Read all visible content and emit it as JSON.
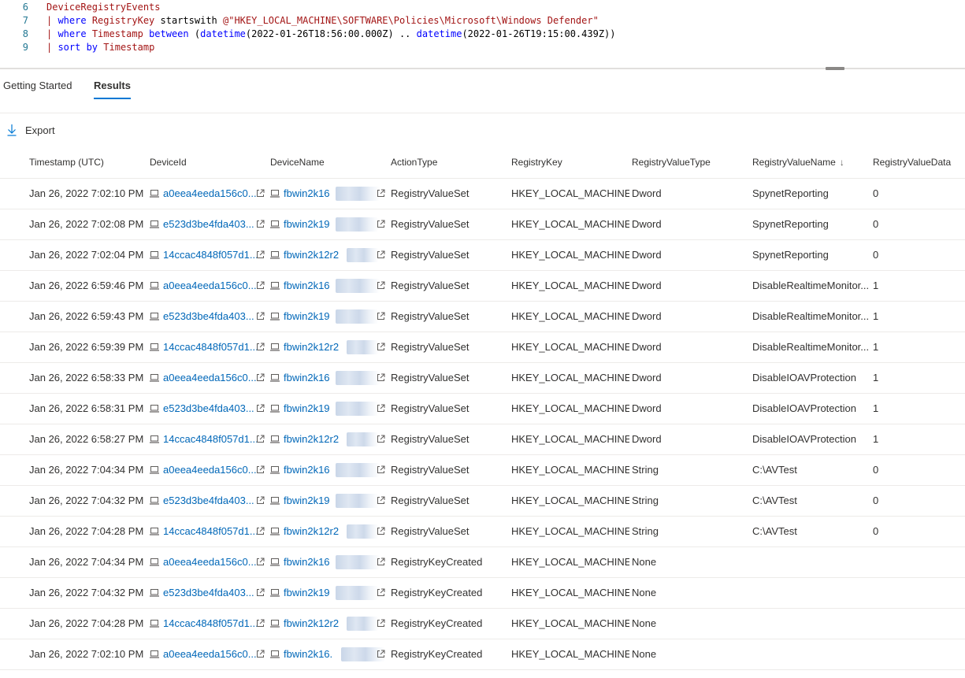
{
  "editor": {
    "lines": [
      {
        "num": "6",
        "tokens": [
          {
            "t": "DeviceRegistryEvents",
            "c": "table"
          }
        ]
      },
      {
        "num": "7",
        "tokens": [
          {
            "t": "| ",
            "c": "pipe"
          },
          {
            "t": "where ",
            "c": "kw"
          },
          {
            "t": "RegistryKey ",
            "c": "ident"
          },
          {
            "t": "startswith ",
            "c": "plain"
          },
          {
            "t": "@\"HKEY_LOCAL_MACHINE\\SOFTWARE\\Policies\\Microsoft\\Windows Defender\"",
            "c": "str"
          }
        ]
      },
      {
        "num": "8",
        "tokens": [
          {
            "t": "| ",
            "c": "pipe"
          },
          {
            "t": "where ",
            "c": "kw"
          },
          {
            "t": "Timestamp ",
            "c": "ident"
          },
          {
            "t": "between ",
            "c": "kw"
          },
          {
            "t": "(",
            "c": "plain"
          },
          {
            "t": "datetime",
            "c": "fn"
          },
          {
            "t": "(2022-01-26T18:56:00.000Z) .. ",
            "c": "plain"
          },
          {
            "t": "datetime",
            "c": "fn"
          },
          {
            "t": "(2022-01-26T19:15:00.439Z))",
            "c": "plain"
          }
        ]
      },
      {
        "num": "9",
        "tokens": [
          {
            "t": "| ",
            "c": "pipe"
          },
          {
            "t": "sort ",
            "c": "kw"
          },
          {
            "t": "by ",
            "c": "kw"
          },
          {
            "t": "Timestamp",
            "c": "ident"
          }
        ]
      }
    ]
  },
  "tabs": {
    "getting_started": "Getting Started",
    "results": "Results"
  },
  "toolbar": {
    "export_label": "Export",
    "export_icon": "download-arrow-icon"
  },
  "grid": {
    "columns": {
      "timestamp": "Timestamp (UTC)",
      "device_id": "DeviceId",
      "device_name": "DeviceName",
      "action_type": "ActionType",
      "registry_key": "RegistryKey",
      "registry_value_type": "RegistryValueType",
      "registry_value_name": "RegistryValueName",
      "registry_value_data": "RegistryValueData"
    },
    "sort_indicator": "↓",
    "rows": [
      {
        "timestamp": "Jan 26, 2022 7:02:10 PM",
        "device_id": "a0eea4eeda156c0...",
        "device_name": "fbwin2k16",
        "action_type": "RegistryValueSet",
        "registry_key": "HKEY_LOCAL_MACHINE...",
        "value_type": "Dword",
        "value_name": "SpynetReporting",
        "value_data": "0"
      },
      {
        "timestamp": "Jan 26, 2022 7:02:08 PM",
        "device_id": "e523d3be4fda403...",
        "device_name": "fbwin2k19",
        "action_type": "RegistryValueSet",
        "registry_key": "HKEY_LOCAL_MACHINE...",
        "value_type": "Dword",
        "value_name": "SpynetReporting",
        "value_data": "0"
      },
      {
        "timestamp": "Jan 26, 2022 7:02:04 PM",
        "device_id": "14ccac4848f057d1...",
        "device_name": "fbwin2k12r2",
        "action_type": "RegistryValueSet",
        "registry_key": "HKEY_LOCAL_MACHINE...",
        "value_type": "Dword",
        "value_name": "SpynetReporting",
        "value_data": "0"
      },
      {
        "timestamp": "Jan 26, 2022 6:59:46 PM",
        "device_id": "a0eea4eeda156c0...",
        "device_name": "fbwin2k16",
        "action_type": "RegistryValueSet",
        "registry_key": "HKEY_LOCAL_MACHINE...",
        "value_type": "Dword",
        "value_name": "DisableRealtimeMonitor...",
        "value_data": "1"
      },
      {
        "timestamp": "Jan 26, 2022 6:59:43 PM",
        "device_id": "e523d3be4fda403...",
        "device_name": "fbwin2k19",
        "action_type": "RegistryValueSet",
        "registry_key": "HKEY_LOCAL_MACHINE...",
        "value_type": "Dword",
        "value_name": "DisableRealtimeMonitor...",
        "value_data": "1"
      },
      {
        "timestamp": "Jan 26, 2022 6:59:39 PM",
        "device_id": "14ccac4848f057d1...",
        "device_name": "fbwin2k12r2",
        "action_type": "RegistryValueSet",
        "registry_key": "HKEY_LOCAL_MACHINE...",
        "value_type": "Dword",
        "value_name": "DisableRealtimeMonitor...",
        "value_data": "1"
      },
      {
        "timestamp": "Jan 26, 2022 6:58:33 PM",
        "device_id": "a0eea4eeda156c0...",
        "device_name": "fbwin2k16",
        "action_type": "RegistryValueSet",
        "registry_key": "HKEY_LOCAL_MACHINE...",
        "value_type": "Dword",
        "value_name": "DisableIOAVProtection",
        "value_data": "1"
      },
      {
        "timestamp": "Jan 26, 2022 6:58:31 PM",
        "device_id": "e523d3be4fda403...",
        "device_name": "fbwin2k19",
        "action_type": "RegistryValueSet",
        "registry_key": "HKEY_LOCAL_MACHINE...",
        "value_type": "Dword",
        "value_name": "DisableIOAVProtection",
        "value_data": "1"
      },
      {
        "timestamp": "Jan 26, 2022 6:58:27 PM",
        "device_id": "14ccac4848f057d1...",
        "device_name": "fbwin2k12r2",
        "action_type": "RegistryValueSet",
        "registry_key": "HKEY_LOCAL_MACHINE...",
        "value_type": "Dword",
        "value_name": "DisableIOAVProtection",
        "value_data": "1"
      },
      {
        "timestamp": "Jan 26, 2022 7:04:34 PM",
        "device_id": "a0eea4eeda156c0...",
        "device_name": "fbwin2k16",
        "action_type": "RegistryValueSet",
        "registry_key": "HKEY_LOCAL_MACHINE...",
        "value_type": "String",
        "value_name": "C:\\AVTest",
        "value_data": "0"
      },
      {
        "timestamp": "Jan 26, 2022 7:04:32 PM",
        "device_id": "e523d3be4fda403...",
        "device_name": "fbwin2k19",
        "action_type": "RegistryValueSet",
        "registry_key": "HKEY_LOCAL_MACHINE...",
        "value_type": "String",
        "value_name": "C:\\AVTest",
        "value_data": "0"
      },
      {
        "timestamp": "Jan 26, 2022 7:04:28 PM",
        "device_id": "14ccac4848f057d1...",
        "device_name": "fbwin2k12r2",
        "action_type": "RegistryValueSet",
        "registry_key": "HKEY_LOCAL_MACHINE...",
        "value_type": "String",
        "value_name": "C:\\AVTest",
        "value_data": "0"
      },
      {
        "timestamp": "Jan 26, 2022 7:04:34 PM",
        "device_id": "a0eea4eeda156c0...",
        "device_name": "fbwin2k16",
        "action_type": "RegistryKeyCreated",
        "registry_key": "HKEY_LOCAL_MACHINE...",
        "value_type": "None",
        "value_name": "",
        "value_data": ""
      },
      {
        "timestamp": "Jan 26, 2022 7:04:32 PM",
        "device_id": "e523d3be4fda403...",
        "device_name": "fbwin2k19",
        "action_type": "RegistryKeyCreated",
        "registry_key": "HKEY_LOCAL_MACHINE...",
        "value_type": "None",
        "value_name": "",
        "value_data": ""
      },
      {
        "timestamp": "Jan 26, 2022 7:04:28 PM",
        "device_id": "14ccac4848f057d1...",
        "device_name": "fbwin2k12r2",
        "action_type": "RegistryKeyCreated",
        "registry_key": "HKEY_LOCAL_MACHINE...",
        "value_type": "None",
        "value_name": "",
        "value_data": ""
      },
      {
        "timestamp": "Jan 26, 2022 7:02:10 PM",
        "device_id": "a0eea4eeda156c0...",
        "device_name": "fbwin2k16.",
        "action_type": "RegistryKeyCreated",
        "registry_key": "HKEY_LOCAL_MACHINE...",
        "value_type": "None",
        "value_name": "",
        "value_data": ""
      }
    ]
  },
  "colors": {
    "accent": "#0078d4",
    "link": "#0067b8",
    "line_number": "#237893",
    "keyword": "#0000ff",
    "identifier": "#a31515"
  }
}
